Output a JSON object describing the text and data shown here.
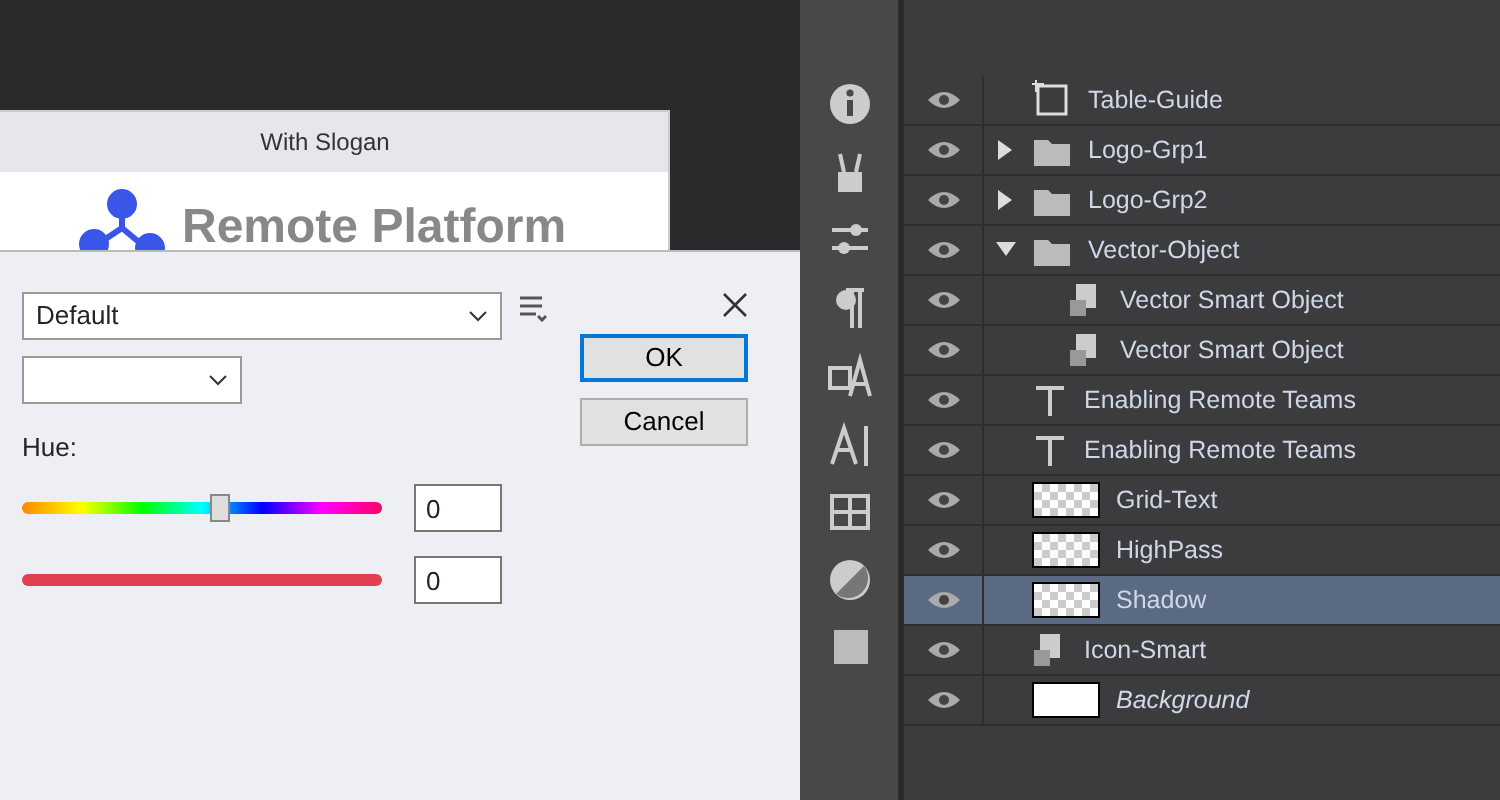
{
  "back_window": {
    "title": "With Slogan",
    "logo_text": "Remote Platform"
  },
  "dialog": {
    "preset": {
      "value": "Default"
    },
    "hue": {
      "label": "Hue:",
      "level": 0.55,
      "value": "0"
    },
    "second_value": "0",
    "buttons": [
      {
        "label": "OK",
        "default": true
      },
      {
        "label": "Cancel",
        "default": false
      }
    ]
  },
  "layers": [
    {
      "name": "Table-Guide",
      "kind": "frame",
      "visible": true,
      "selected": false
    },
    {
      "name": "Logo-Grp1",
      "kind": "group",
      "visible": true,
      "selected": false,
      "expanded": false
    },
    {
      "name": "Logo-Grp2",
      "kind": "group",
      "visible": true,
      "selected": false,
      "expanded": false
    },
    {
      "name": "Vector-Object",
      "kind": "group",
      "visible": true,
      "selected": false,
      "expanded": true,
      "children": [
        {
          "name": "Vector Smart Object",
          "kind": "smart",
          "visible": true,
          "selected": false
        },
        {
          "name": "Vector Smart Object",
          "kind": "smart",
          "visible": true,
          "selected": false
        }
      ]
    },
    {
      "name": "Enabling Remote Teams",
      "kind": "text",
      "visible": true,
      "selected": false
    },
    {
      "name": "Enabling Remote Teams",
      "kind": "text",
      "visible": true,
      "selected": false
    },
    {
      "name": "Grid-Text",
      "kind": "pixel",
      "visible": true,
      "selected": false
    },
    {
      "name": "HighPass",
      "kind": "pixel",
      "visible": true,
      "selected": false
    },
    {
      "name": "Shadow",
      "kind": "pixel",
      "visible": true,
      "selected": true
    },
    {
      "name": "Icon-Smart",
      "kind": "smart",
      "visible": true,
      "selected": false
    },
    {
      "name": "Background",
      "kind": "fill",
      "visible": true,
      "selected": false
    }
  ]
}
